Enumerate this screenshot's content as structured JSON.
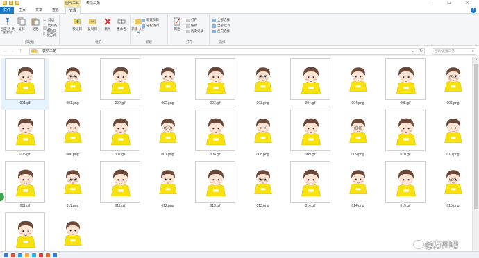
{
  "titlebar": {
    "context_tab": "图片工具",
    "title": "表情二弟",
    "minimize": "—",
    "maximize": "☐",
    "close": "✕"
  },
  "tabs": {
    "file": "文件",
    "home": "主页",
    "share": "共享",
    "view": "查看",
    "manage": "管理",
    "help": "?"
  },
  "ribbon": {
    "clipboard": {
      "label": "剪贴板",
      "pin": "固定到\"快速访问\"",
      "copy": "复制",
      "paste": "粘贴",
      "cut": "剪切",
      "copy_path": "复制路径",
      "paste_shortcut": "粘贴快捷方式"
    },
    "organize": {
      "label": "组织",
      "move_to": "移动到",
      "copy_to": "复制到",
      "delete": "删除",
      "rename": "重命名"
    },
    "new": {
      "label": "新建",
      "new_folder": "新建\n文件夹",
      "new_item": "新建项目",
      "easy_access": "轻松访问"
    },
    "open": {
      "label": "打开",
      "properties": "属性",
      "open": "打开",
      "edit": "编辑",
      "history": "历史记录"
    },
    "select": {
      "label": "选择",
      "select_all": "全部选择",
      "select_none": "全部取消",
      "invert": "反向选择"
    }
  },
  "address": {
    "back": "←",
    "forward": "→",
    "up": "↑",
    "crumb_sep": "›",
    "crumb": "表情二弟",
    "dropdown": "⌄",
    "refresh": "↻",
    "search_placeholder": "搜索\"表情二弟\"",
    "search_icon": "⌕"
  },
  "files": [
    {
      "name": "001.gif",
      "kind": "gif",
      "selected": true
    },
    {
      "name": "001.png",
      "kind": "png"
    },
    {
      "name": "002.gif",
      "kind": "gif"
    },
    {
      "name": "002.png",
      "kind": "png"
    },
    {
      "name": "003.gif",
      "kind": "gif"
    },
    {
      "name": "003.png",
      "kind": "png"
    },
    {
      "name": "004.gif",
      "kind": "gif"
    },
    {
      "name": "004.png",
      "kind": "png"
    },
    {
      "name": "005.gif",
      "kind": "gif"
    },
    {
      "name": "005.png",
      "kind": "png"
    },
    {
      "name": "006.gif",
      "kind": "gif"
    },
    {
      "name": "006.png",
      "kind": "png"
    },
    {
      "name": "007.gif",
      "kind": "gif"
    },
    {
      "name": "007.png",
      "kind": "png"
    },
    {
      "name": "008.gif",
      "kind": "gif"
    },
    {
      "name": "008.png",
      "kind": "png"
    },
    {
      "name": "009.gif",
      "kind": "gif"
    },
    {
      "name": "009.png",
      "kind": "png"
    },
    {
      "name": "010.gif",
      "kind": "gif"
    },
    {
      "name": "010.png",
      "kind": "png"
    },
    {
      "name": "011.gif",
      "kind": "gif"
    },
    {
      "name": "011.png",
      "kind": "png"
    },
    {
      "name": "012.gif",
      "kind": "gif"
    },
    {
      "name": "012.png",
      "kind": "png"
    },
    {
      "name": "013.gif",
      "kind": "gif"
    },
    {
      "name": "013.png",
      "kind": "png"
    },
    {
      "name": "014.gif",
      "kind": "gif"
    },
    {
      "name": "014.png",
      "kind": "png"
    },
    {
      "name": "015.gif",
      "kind": "gif"
    },
    {
      "name": "015.png",
      "kind": "png"
    },
    {
      "name": "",
      "kind": "gif"
    },
    {
      "name": "",
      "kind": "png"
    }
  ],
  "watermark": "@万州吧",
  "colors": {
    "accent": "#1979ca",
    "shirt": "#f7e20f",
    "hair": "#6b4a3a",
    "skin": "#fde3d3",
    "selection": "#e5f3ff"
  }
}
